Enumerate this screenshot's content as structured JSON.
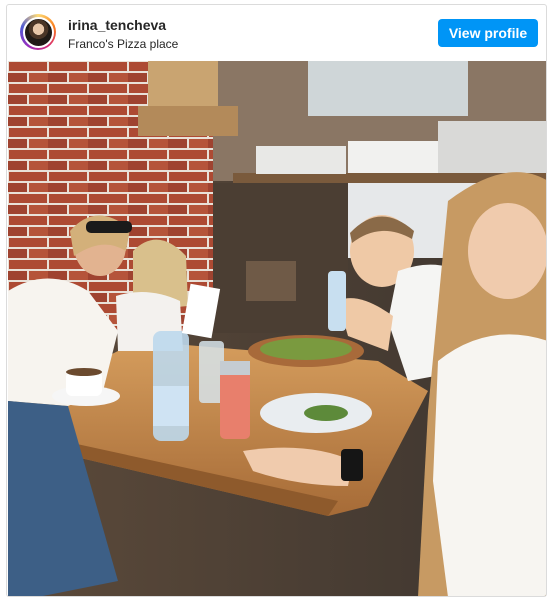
{
  "post": {
    "username": "irina_tencheva",
    "location": "Franco's Pizza place",
    "view_profile_label": "View profile"
  },
  "photo": {
    "subject": "family-at-pizza-restaurant"
  },
  "colors": {
    "button": "#0095f6",
    "border": "#dbdbdb",
    "text": "#262626",
    "brick": "#a8452f",
    "table": "#c48a4f"
  }
}
